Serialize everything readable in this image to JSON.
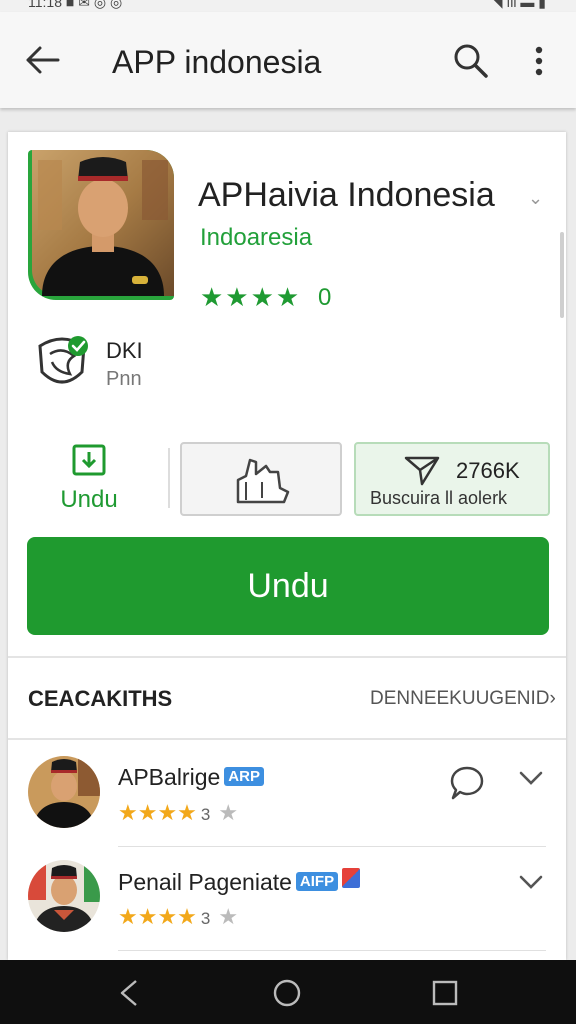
{
  "status_bar": {
    "left_text": "11:18 ■ ✉ ◎ ◎",
    "right_text": "◥ ıll ▬ ▮"
  },
  "app_bar": {
    "title": "APP indonesia",
    "back_icon": "arrow-left-icon",
    "search_icon": "search-icon",
    "more_icon": "more-vert-icon"
  },
  "app": {
    "name": "APHaivia Indonesia",
    "developer": "Indoaresia",
    "stars": "★★★★",
    "rating_count": "0",
    "accent": "#1f9a2f"
  },
  "developer_info": {
    "name": "DKI",
    "subtitle": "Pnn",
    "icon": "verified-shield-icon"
  },
  "actions": {
    "download_label": "Undu",
    "count_value": "2766K",
    "count_subtitle": "Buscuira ll aolerk"
  },
  "install_button": {
    "label": "Undu"
  },
  "reviews_section": {
    "title": "CEACAKITHS",
    "see_more": "DENNEEKUUGENID",
    "items": [
      {
        "name": "APBalrige",
        "badge": "ARP",
        "stars": "★★★★",
        "count": "3",
        "extra_star": "★"
      },
      {
        "name": "Penail Pageniate",
        "badge": "AIFP",
        "stars": "★★★★",
        "count": "3",
        "extra_star": "★"
      }
    ]
  },
  "nav_bar": {
    "back": "nav-back-icon",
    "home": "nav-home-icon",
    "recents": "nav-recents-icon"
  }
}
